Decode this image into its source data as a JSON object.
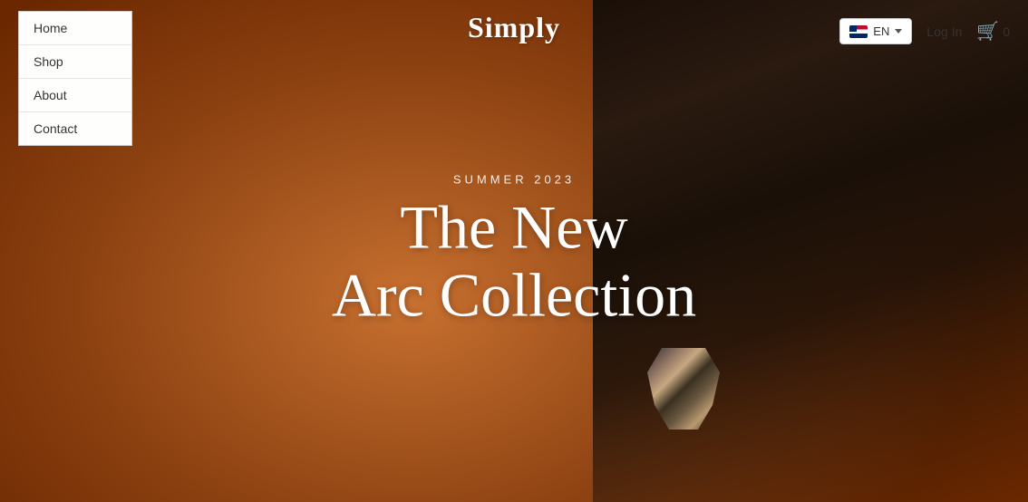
{
  "brand": {
    "name": "Simply"
  },
  "nav": {
    "items": [
      {
        "label": "Home",
        "id": "home"
      },
      {
        "label": "Shop",
        "id": "shop"
      },
      {
        "label": "About",
        "id": "about"
      },
      {
        "label": "Contact",
        "id": "contact"
      }
    ]
  },
  "header": {
    "lang": {
      "code": "EN",
      "flag_alt": "US Flag"
    },
    "login_label": "Log In",
    "cart": {
      "count": "0"
    }
  },
  "hero": {
    "subtitle": "SUMMER 2023",
    "title_line1": "The New",
    "title_line2": "Arc Collection"
  }
}
